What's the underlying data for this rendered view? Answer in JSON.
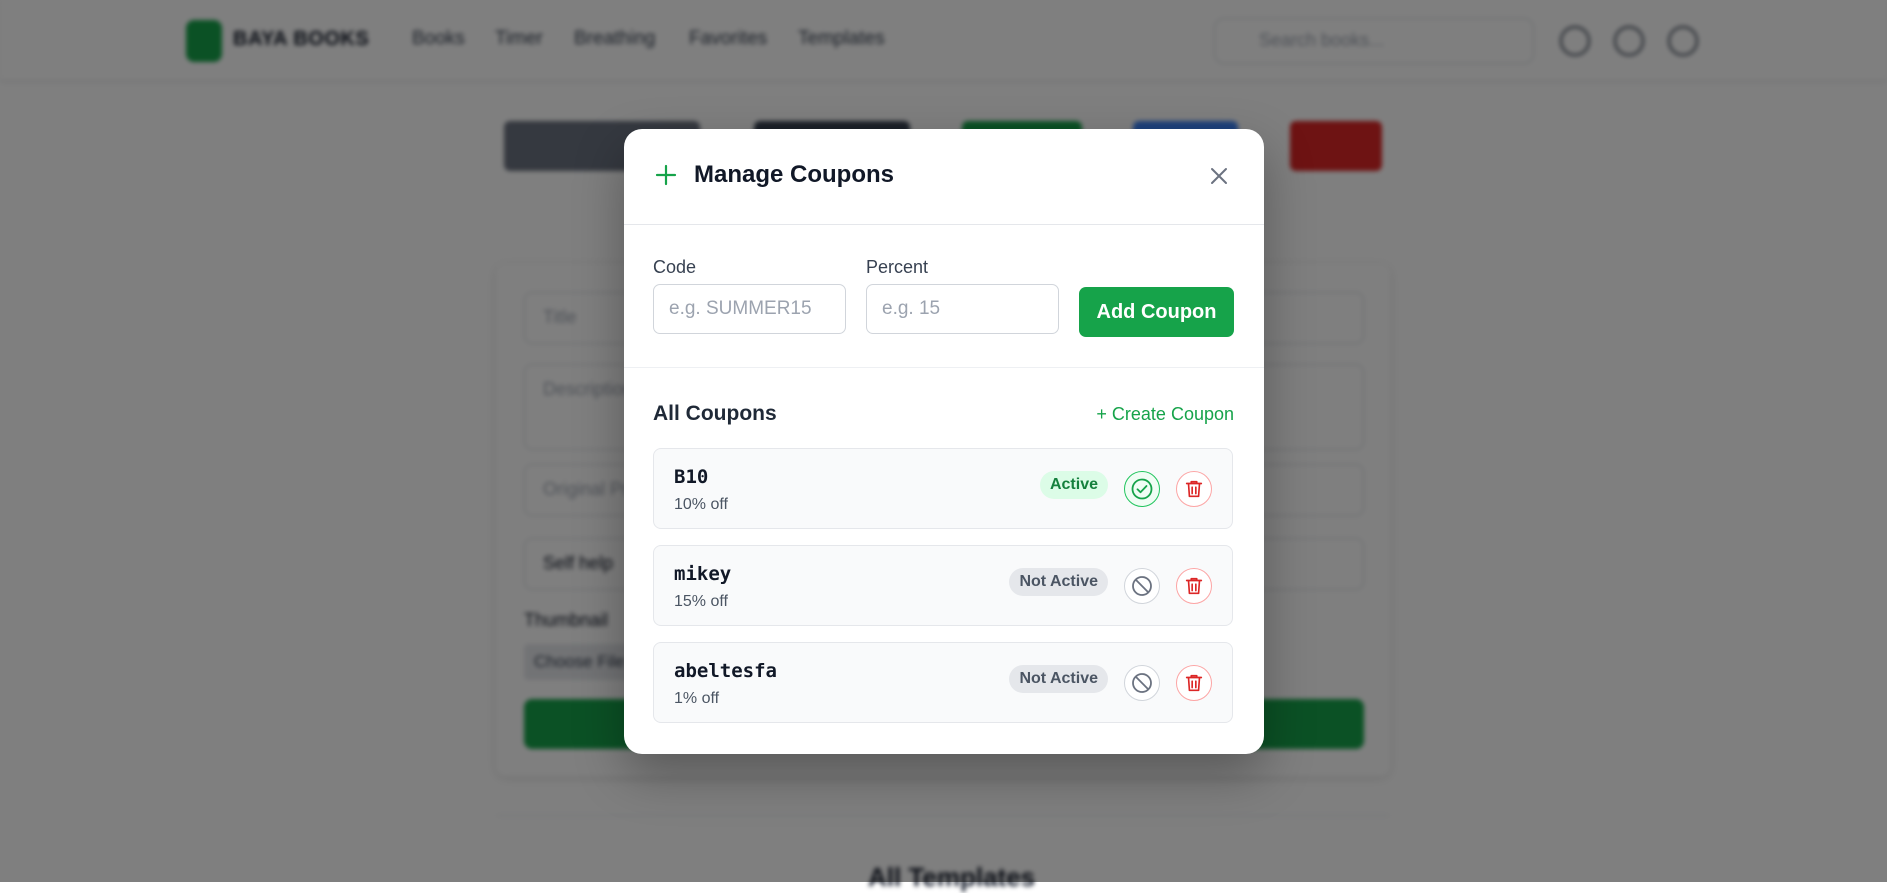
{
  "background": {
    "brand": "BAYA BOOKS",
    "nav_links": [
      "Books",
      "Timer",
      "Breathing",
      "Favorites",
      "Templates"
    ],
    "search_placeholder": "Search books...",
    "form_placeholders": {
      "title": "Title",
      "description": "Description",
      "original_price": "Original Price",
      "category": "Self help"
    },
    "thumbnail_label": "Thumbnail",
    "choose_file": "Choose File",
    "section_title": "All Templates"
  },
  "modal": {
    "title": "Manage Coupons",
    "form": {
      "code_label": "Code",
      "code_placeholder": "e.g. SUMMER15",
      "percent_label": "Percent",
      "percent_placeholder": "e.g. 15",
      "add_button": "Add Coupon"
    },
    "list_title": "All Coupons",
    "create_link": "+ Create Coupon",
    "coupons": [
      {
        "code": "B10",
        "discount": "10% off",
        "status": "Active"
      },
      {
        "code": "mikey",
        "discount": "15% off",
        "status": "Not Active"
      },
      {
        "code": "abeltesfa",
        "discount": "1% off",
        "status": "Not Active"
      }
    ]
  },
  "colors": {
    "accent": "#16a34a",
    "danger": "#dc2626",
    "overlay": "rgba(0,0,0,0.5)"
  },
  "icons": [
    "plus-icon",
    "close-icon",
    "check-circle-icon",
    "ban-icon",
    "trash-icon",
    "search-icon",
    "heart-icon",
    "user-icon",
    "cart-icon"
  ]
}
